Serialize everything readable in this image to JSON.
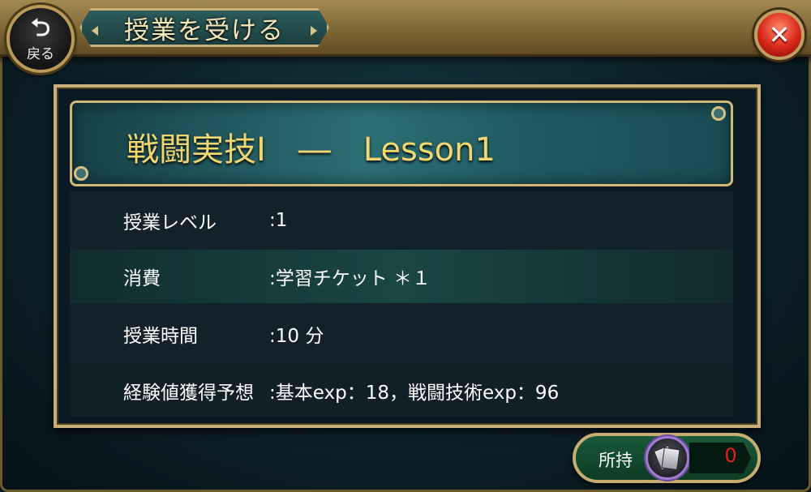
{
  "header": {
    "back_arrow": "⮌",
    "back_label": "戻る",
    "title": "授業を受ける",
    "close_symbol": "✕"
  },
  "lesson": {
    "title": "戦闘実技Ⅰ　―　Lesson1"
  },
  "details": [
    {
      "label": "授業レベル",
      "value": ":1"
    },
    {
      "label": "消費",
      "value": ":学習チケット ＊１"
    },
    {
      "label": "授業時間",
      "value": ":10 分"
    },
    {
      "label": "経験値獲得予想",
      "value": ":基本exp：18，戦闘技術exp：96"
    }
  ],
  "owned": {
    "label": "所持",
    "count": "0"
  },
  "colors": {
    "accent_gold": "#c9b07a",
    "title_yellow": "#f1d772",
    "count_red": "#e3221a",
    "close_red": "#d8261a"
  },
  "icons": [
    "back-arrow-icon",
    "close-icon",
    "ticket-icon"
  ]
}
